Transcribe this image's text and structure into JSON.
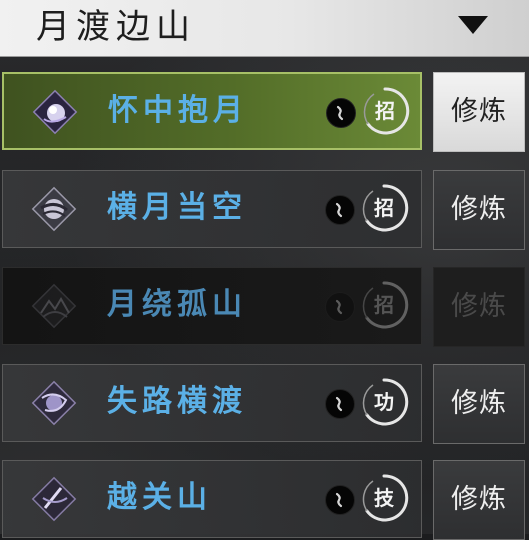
{
  "header": {
    "title": "月渡边山",
    "dropdown_icon": "triangle-down-icon"
  },
  "skills": [
    {
      "name": "怀中抱月",
      "type": "招",
      "train_label": "修炼",
      "state": "selected",
      "icon": "moon-orb-icon"
    },
    {
      "name": "横月当空",
      "type": "招",
      "train_label": "修炼",
      "state": "normal",
      "icon": "crescent-slash-icon"
    },
    {
      "name": "月绕孤山",
      "type": "招",
      "train_label": "修炼",
      "state": "locked",
      "icon": "mountain-swirl-icon"
    },
    {
      "name": "失路横渡",
      "type": "功",
      "train_label": "修炼",
      "state": "normal",
      "icon": "orb-swirl-icon"
    },
    {
      "name": "越关山",
      "type": "技",
      "train_label": "修炼",
      "state": "normal",
      "icon": "blade-swirl-icon"
    }
  ],
  "colors": {
    "skill_name": "#5bb0e6",
    "selected_row": "#536d28",
    "selected_border": "#a7c067"
  }
}
